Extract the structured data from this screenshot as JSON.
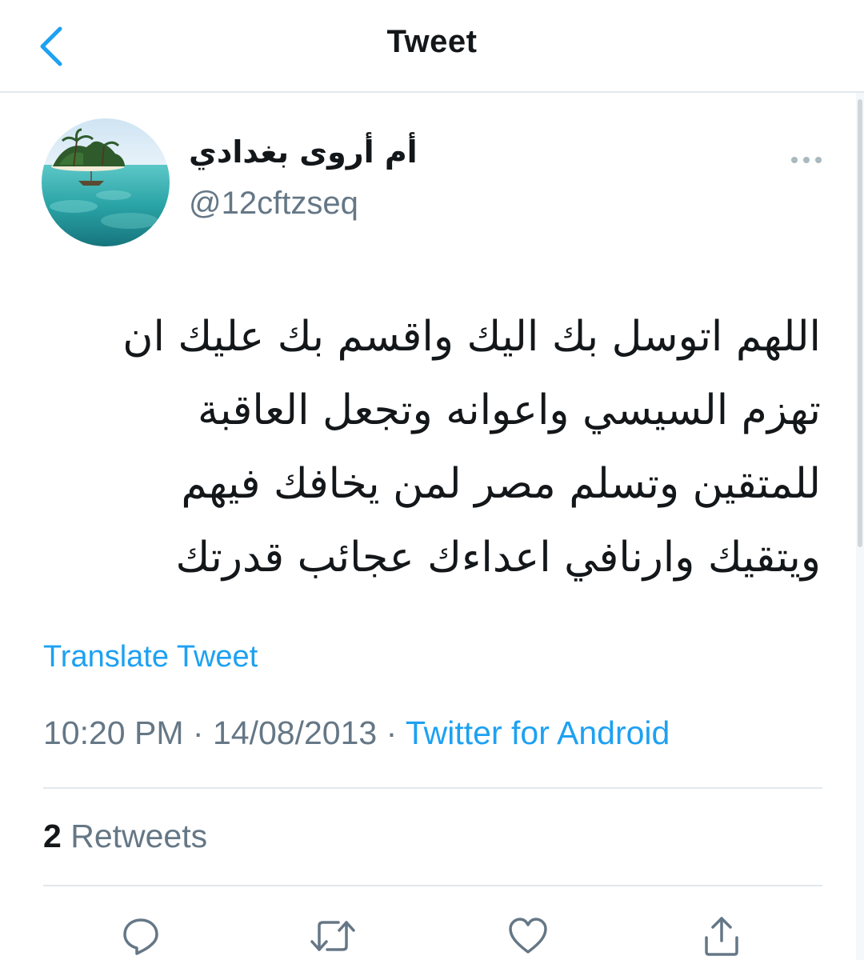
{
  "header": {
    "title": "Tweet",
    "back_icon": "chevron-left-icon"
  },
  "colors": {
    "accent": "#1da1f2",
    "text_primary": "#14171a",
    "text_secondary": "#657786",
    "divider": "#e1e8ed"
  },
  "author": {
    "display_name": "أم أروى بغدادي",
    "handle": "@12cftzseq",
    "avatar_icon": "beach-island-avatar",
    "more_icon": "more-dots-icon"
  },
  "tweet": {
    "text": "اللهم اتوسل بك اليك واقسم بك عليك ان\nتهزم السيسي واعوانه وتجعل العاقبة\nللمتقين وتسلم مصر لمن يخافك فيهم\nويتقيك وارنافي اعداءك عجائب قدرتك",
    "translate_label": "Translate Tweet",
    "time": "10:20 PM",
    "date": "14/08/2013",
    "separator": "·",
    "source": "Twitter for Android"
  },
  "stats": {
    "retweets_count": "2",
    "retweets_label": "Retweets"
  },
  "actions": [
    {
      "name": "reply",
      "icon": "reply-bubble-icon"
    },
    {
      "name": "retweet",
      "icon": "retweet-icon"
    },
    {
      "name": "like",
      "icon": "heart-icon"
    },
    {
      "name": "share",
      "icon": "share-icon"
    }
  ]
}
